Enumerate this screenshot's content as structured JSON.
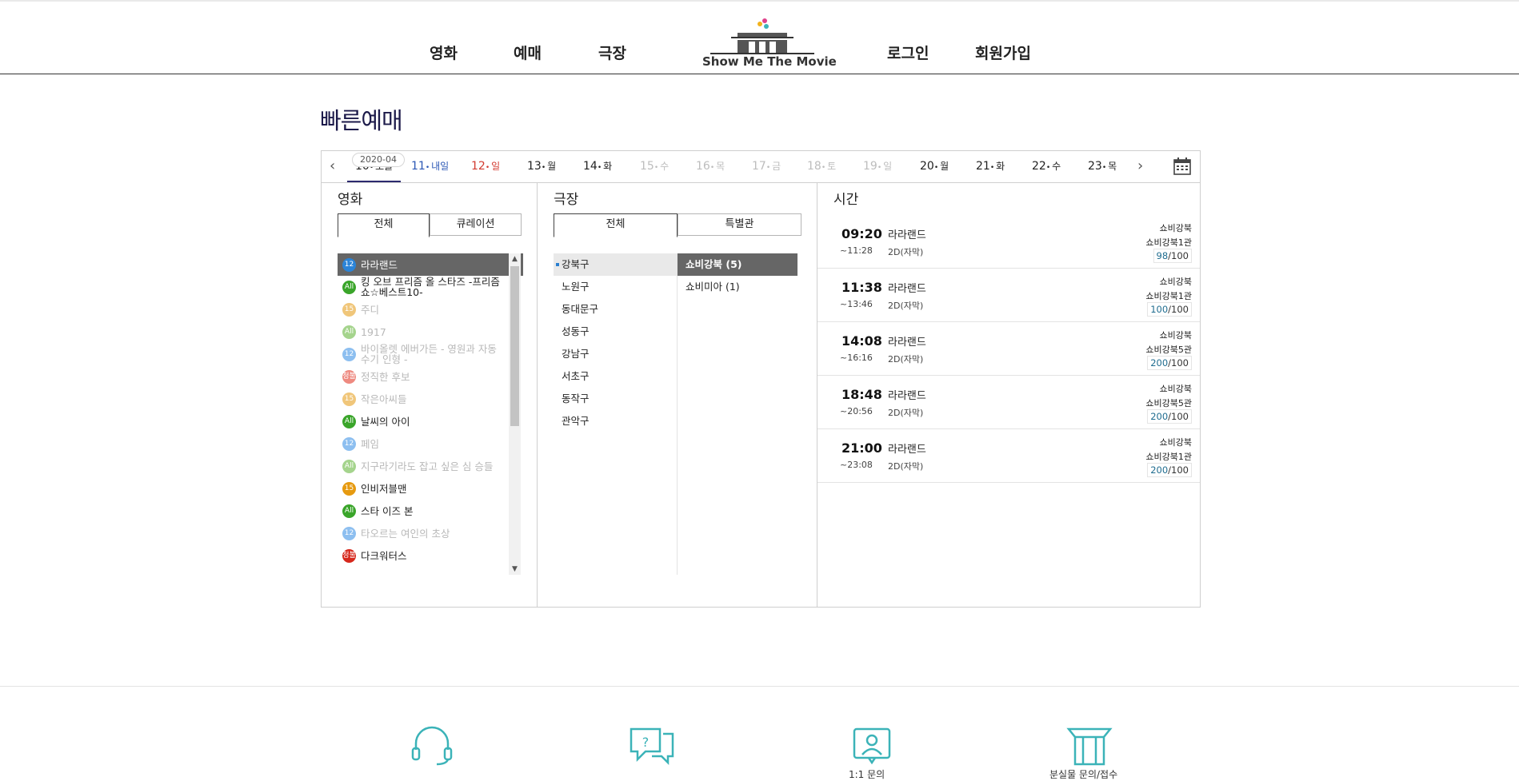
{
  "nav": {
    "left": [
      "영화",
      "예매",
      "극장"
    ],
    "right": [
      "로그인",
      "회원가입"
    ],
    "logo_text": "Show Me The Movie"
  },
  "page_title": "빠른예매",
  "dates": {
    "year_month": "2020-04",
    "items": [
      {
        "num": "10",
        "day": "오늘",
        "kind": "active"
      },
      {
        "num": "11",
        "day": "내일",
        "kind": "sat"
      },
      {
        "num": "12",
        "day": "일",
        "kind": "sun"
      },
      {
        "num": "13",
        "day": "월",
        "kind": "normal"
      },
      {
        "num": "14",
        "day": "화",
        "kind": "normal"
      },
      {
        "num": "15",
        "day": "수",
        "kind": "disabled"
      },
      {
        "num": "16",
        "day": "목",
        "kind": "disabled"
      },
      {
        "num": "17",
        "day": "금",
        "kind": "disabled"
      },
      {
        "num": "18",
        "day": "토",
        "kind": "disabled"
      },
      {
        "num": "19",
        "day": "일",
        "kind": "disabled"
      },
      {
        "num": "20",
        "day": "월",
        "kind": "normal"
      },
      {
        "num": "21",
        "day": "화",
        "kind": "normal"
      },
      {
        "num": "22",
        "day": "수",
        "kind": "normal"
      },
      {
        "num": "23",
        "day": "목",
        "kind": "normal"
      }
    ]
  },
  "movie_col": {
    "title": "영화",
    "tabs": [
      "전체",
      "큐레이션"
    ],
    "movies": [
      {
        "rating": "12",
        "color": "#2b84d8",
        "name": "라라랜드",
        "state": "sel"
      },
      {
        "rating": "All",
        "color": "#3aa52a",
        "name": "킹 오브 프리즘 올 스타즈 -프리즘 쇼☆베스트10-",
        "state": "normal"
      },
      {
        "rating": "15",
        "color": "#f0c67a",
        "name": "주디",
        "state": "dim"
      },
      {
        "rating": "All",
        "color": "#a5d48d",
        "name": "1917",
        "state": "dim"
      },
      {
        "rating": "12",
        "color": "#8dbff0",
        "name": "바이올렛 에버가든 - 영원과 자동 수기 인형 -",
        "state": "dim"
      },
      {
        "rating": "청불",
        "color": "#ee8a80",
        "name": "정직한 후보",
        "state": "dim"
      },
      {
        "rating": "15",
        "color": "#f0c67a",
        "name": "작은아씨들",
        "state": "dim"
      },
      {
        "rating": "All",
        "color": "#3aa52a",
        "name": "날씨의 아이",
        "state": "normal"
      },
      {
        "rating": "12",
        "color": "#8dbff0",
        "name": "페임",
        "state": "dim"
      },
      {
        "rating": "All",
        "color": "#a5d48d",
        "name": "지구라기라도 잡고 싶은 심 승들",
        "state": "dim"
      },
      {
        "rating": "15",
        "color": "#e69a10",
        "name": "인비저블맨",
        "state": "normal"
      },
      {
        "rating": "All",
        "color": "#3aa52a",
        "name": "스타 이즈 본",
        "state": "normal"
      },
      {
        "rating": "12",
        "color": "#8dbff0",
        "name": "타오르는 여인의 초상",
        "state": "dim"
      },
      {
        "rating": "청불",
        "color": "#d6281c",
        "name": "다크워터스",
        "state": "normal"
      }
    ]
  },
  "theater_col": {
    "title": "극장",
    "tabs": [
      "전체",
      "특별관"
    ],
    "regions": [
      "강북구",
      "노원구",
      "동대문구",
      "성동구",
      "강남구",
      "서초구",
      "동작구",
      "관악구"
    ],
    "cinemas": [
      "쇼비강북 (5)",
      "쇼비미아 (1)"
    ]
  },
  "time_col": {
    "title": "시간",
    "showtimes": [
      {
        "start": "09:20",
        "end": "~11:28",
        "title": "라라랜드",
        "format": "2D(자막)",
        "branch": "쇼비강북",
        "hall": "쇼비강북1관",
        "avail": "98",
        "total": "/100"
      },
      {
        "start": "11:38",
        "end": "~13:46",
        "title": "라라랜드",
        "format": "2D(자막)",
        "branch": "쇼비강북",
        "hall": "쇼비강북1관",
        "avail": "100",
        "total": "/100"
      },
      {
        "start": "14:08",
        "end": "~16:16",
        "title": "라라랜드",
        "format": "2D(자막)",
        "branch": "쇼비강북",
        "hall": "쇼비강북5관",
        "avail": "200",
        "total": "/100"
      },
      {
        "start": "18:48",
        "end": "~20:56",
        "title": "라라랜드",
        "format": "2D(자막)",
        "branch": "쇼비강북",
        "hall": "쇼비강북5관",
        "avail": "200",
        "total": "/100"
      },
      {
        "start": "21:00",
        "end": "~23:08",
        "title": "라라랜드",
        "format": "2D(자막)",
        "branch": "쇼비강북",
        "hall": "쇼비강북1관",
        "avail": "200",
        "total": "/100"
      }
    ]
  },
  "footer": {
    "labels": [
      "",
      "",
      "1:1 문의",
      "분실물 문의/접수"
    ]
  },
  "colors": {
    "accent": "#2c2a6e",
    "teal_icon": "#3bb3b8",
    "selected_bg": "#666666"
  }
}
